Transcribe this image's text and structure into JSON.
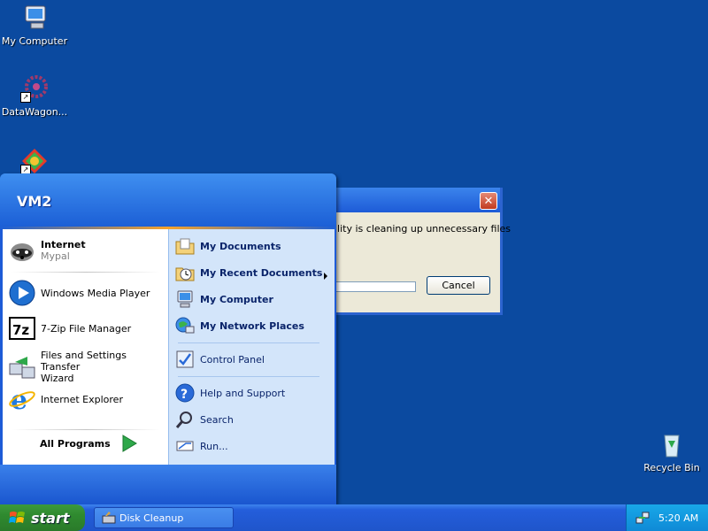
{
  "desktop": {
    "icons": [
      {
        "label": "My Computer",
        "icon": "my-computer-icon"
      },
      {
        "label": "DataWagon...",
        "icon": "datawagon-icon"
      },
      {
        "label": "",
        "icon": "app-shortcut-icon"
      },
      {
        "label": "Recycle Bin",
        "icon": "recycle-bin-icon"
      }
    ]
  },
  "dialog": {
    "title": "",
    "message": "ility is cleaning up unnecessary files",
    "cancel_label": "Cancel",
    "close_glyph": "✕",
    "progress": 0
  },
  "start_menu": {
    "user": "VM2",
    "pinned": [
      {
        "name": "Internet",
        "sub": "Mypal",
        "icon": "mypal-raccoon-icon"
      }
    ],
    "recent": [
      {
        "name": "Windows Media Player",
        "icon": "media-player-icon"
      },
      {
        "name": "7-Zip File Manager",
        "icon": "7zip-icon"
      },
      {
        "name": "Files and Settings Transfer",
        "name2": "Wizard",
        "icon": "transfer-wizard-icon"
      },
      {
        "name": "Internet Explorer",
        "icon": "internet-explorer-icon"
      }
    ],
    "all_programs": "All Programs",
    "right": [
      {
        "name": "My Documents",
        "icon": "folder-documents-icon"
      },
      {
        "name": "My Recent Documents",
        "icon": "recent-documents-icon"
      },
      {
        "name": "My Computer",
        "icon": "computer-icon"
      },
      {
        "name": "My Network Places",
        "icon": "network-icon"
      },
      {
        "name": "Control Panel",
        "icon": "control-panel-icon"
      },
      {
        "name": "Help and Support",
        "icon": "help-icon"
      },
      {
        "name": "Search",
        "icon": "search-icon"
      },
      {
        "name": "Run...",
        "icon": "run-icon"
      }
    ]
  },
  "taskbar": {
    "start_label": "start",
    "task_label": "Disk Cleanup",
    "clock": "5:20 AM"
  },
  "colors": {
    "desktop": "#0b4aa0",
    "start_green": "#2f8a2f",
    "taskbar_blue": "#245edb"
  }
}
